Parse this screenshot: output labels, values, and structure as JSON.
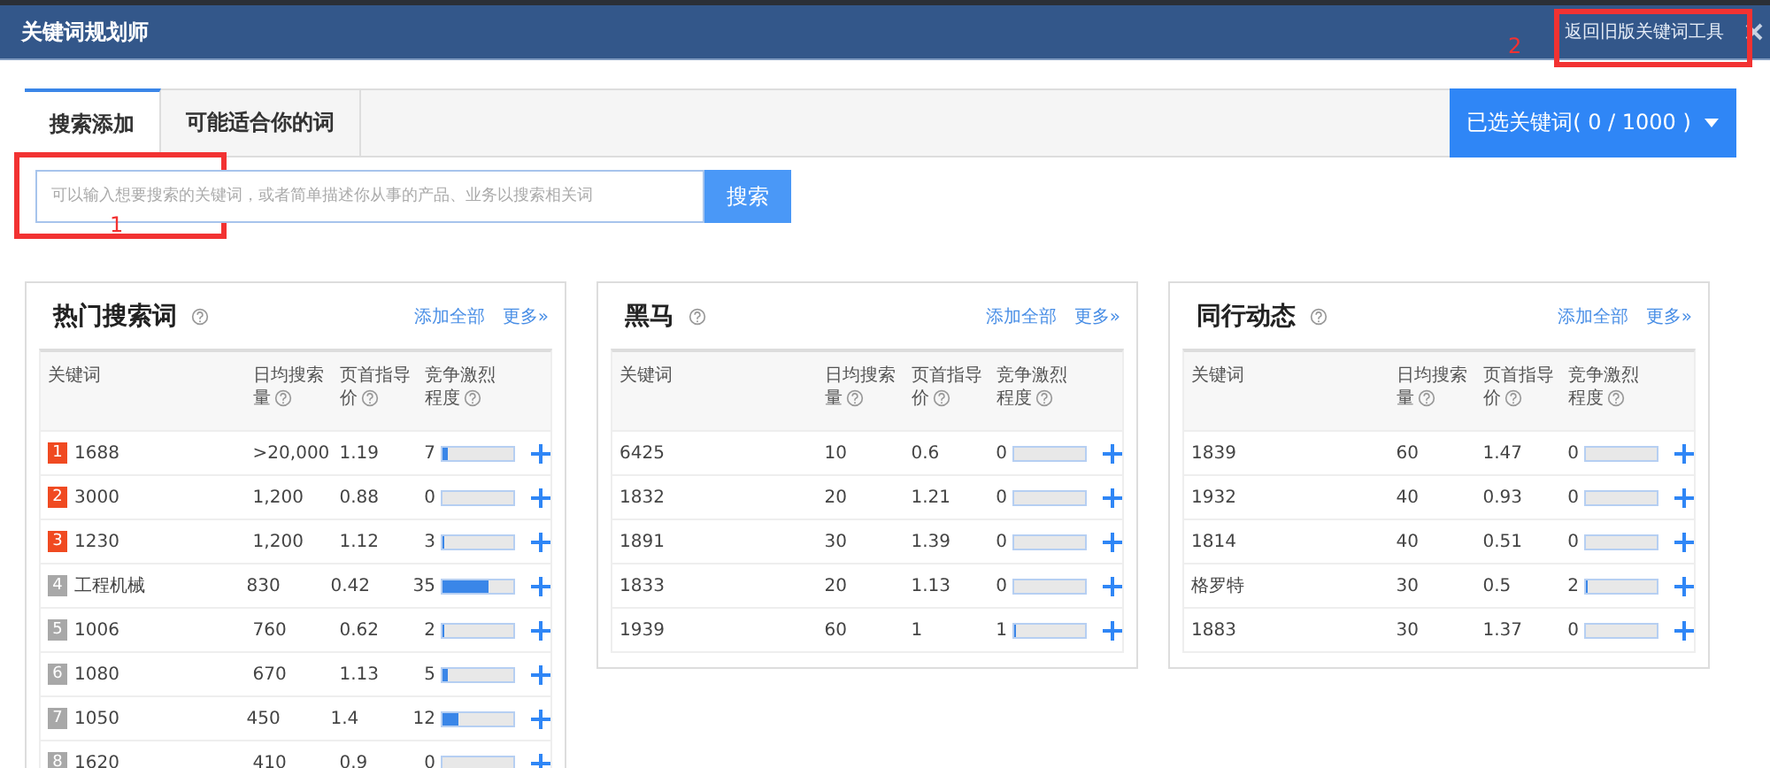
{
  "window": {
    "title": "关键词规划师",
    "old_tool_button": "返回旧版关键词工具"
  },
  "tabs": [
    {
      "label": "搜索添加",
      "selected": true
    },
    {
      "label": "可能适合你的词",
      "selected": false
    }
  ],
  "selected_keywords_button": "已选关键词( 0 / 1000 )",
  "search": {
    "placeholder": "可以输入想要搜索的关键词，或者简单描述你从事的产品、业务以搜索相关词",
    "button": "搜索"
  },
  "panels": [
    {
      "title": "热门搜索词",
      "add_all": "添加全部",
      "more": "更多»",
      "columns": [
        "关键词",
        "日均搜索量",
        "页首指导价",
        "竞争激烈程度"
      ],
      "rows": [
        {
          "rank": "1",
          "top": true,
          "keyword": "1688",
          "searches": ">20,000",
          "price": "1.19",
          "competition": "7",
          "level": 0.08
        },
        {
          "rank": "2",
          "top": true,
          "keyword": "3000",
          "searches": "1,200",
          "price": "0.88",
          "competition": "0",
          "level": 0
        },
        {
          "rank": "3",
          "top": true,
          "keyword": "1230",
          "searches": "1,200",
          "price": "1.12",
          "competition": "3",
          "level": 0.03
        },
        {
          "rank": "4",
          "top": false,
          "keyword": "工程机械",
          "searches": "830",
          "price": "0.42",
          "competition": "35",
          "level": 0.66
        },
        {
          "rank": "5",
          "top": false,
          "keyword": "1006",
          "searches": "760",
          "price": "0.62",
          "competition": "2",
          "level": 0.03
        },
        {
          "rank": "6",
          "top": false,
          "keyword": "1080",
          "searches": "670",
          "price": "1.13",
          "competition": "5",
          "level": 0.08
        },
        {
          "rank": "7",
          "top": false,
          "keyword": "1050",
          "searches": "450",
          "price": "1.4",
          "competition": "12",
          "level": 0.22
        },
        {
          "rank": "8",
          "top": false,
          "keyword": "1620",
          "searches": "410",
          "price": "0.9",
          "competition": "0",
          "level": 0
        }
      ]
    },
    {
      "title": "黑马",
      "add_all": "添加全部",
      "more": "更多»",
      "columns": [
        "关键词",
        "日均搜索量",
        "页首指导价",
        "竞争激烈程度"
      ],
      "rows": [
        {
          "keyword": "6425",
          "searches": "10",
          "price": "0.6",
          "competition": "0",
          "level": 0
        },
        {
          "keyword": "1832",
          "searches": "20",
          "price": "1.21",
          "competition": "0",
          "level": 0
        },
        {
          "keyword": "1891",
          "searches": "30",
          "price": "1.39",
          "competition": "0",
          "level": 0
        },
        {
          "keyword": "1833",
          "searches": "20",
          "price": "1.13",
          "competition": "0",
          "level": 0
        },
        {
          "keyword": "1939",
          "searches": "60",
          "price": "1",
          "competition": "1",
          "level": 0.02
        }
      ]
    },
    {
      "title": "同行动态",
      "add_all": "添加全部",
      "more": "更多»",
      "columns": [
        "关键词",
        "日均搜索量",
        "页首指导价",
        "竞争激烈程度"
      ],
      "rows": [
        {
          "keyword": "1839",
          "searches": "60",
          "price": "1.47",
          "competition": "0",
          "level": 0
        },
        {
          "keyword": "1932",
          "searches": "40",
          "price": "0.93",
          "competition": "0",
          "level": 0
        },
        {
          "keyword": "1814",
          "searches": "40",
          "price": "0.51",
          "competition": "0",
          "level": 0
        },
        {
          "keyword": "格罗特",
          "searches": "30",
          "price": "0.5",
          "competition": "2",
          "level": 0.03
        },
        {
          "keyword": "1883",
          "searches": "30",
          "price": "1.37",
          "competition": "0",
          "level": 0
        }
      ]
    }
  ],
  "annotations": [
    {
      "label": "1"
    },
    {
      "label": "2"
    }
  ]
}
